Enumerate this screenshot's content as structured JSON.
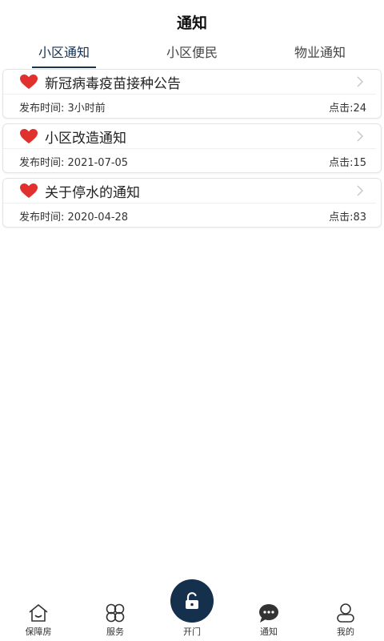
{
  "header": {
    "title": "通知"
  },
  "tabs": [
    {
      "label": "小区通知",
      "active": true
    },
    {
      "label": "小区便民",
      "active": false
    },
    {
      "label": "物业通知",
      "active": false
    }
  ],
  "notices": [
    {
      "title": "新冠病毒疫苗接种公告",
      "time_label": "发布时间:",
      "time": "3小时前",
      "clicks": "点击:24"
    },
    {
      "title": "小区改造通知",
      "time_label": "发布时间:",
      "time": "2021-07-05",
      "clicks": "点击:15"
    },
    {
      "title": "关于停水的通知",
      "time_label": "发布时间:",
      "time": "2020-04-28",
      "clicks": "点击:83"
    }
  ],
  "tabbar": [
    {
      "label": "保障房",
      "icon": "house-icon"
    },
    {
      "label": "服务",
      "icon": "clover-icon"
    },
    {
      "label": "开门",
      "icon": "unlock-icon"
    },
    {
      "label": "通知",
      "icon": "chat-icon"
    },
    {
      "label": "我的",
      "icon": "person-icon"
    }
  ],
  "colors": {
    "accent": "#15304d",
    "heart": "#e0312f"
  }
}
